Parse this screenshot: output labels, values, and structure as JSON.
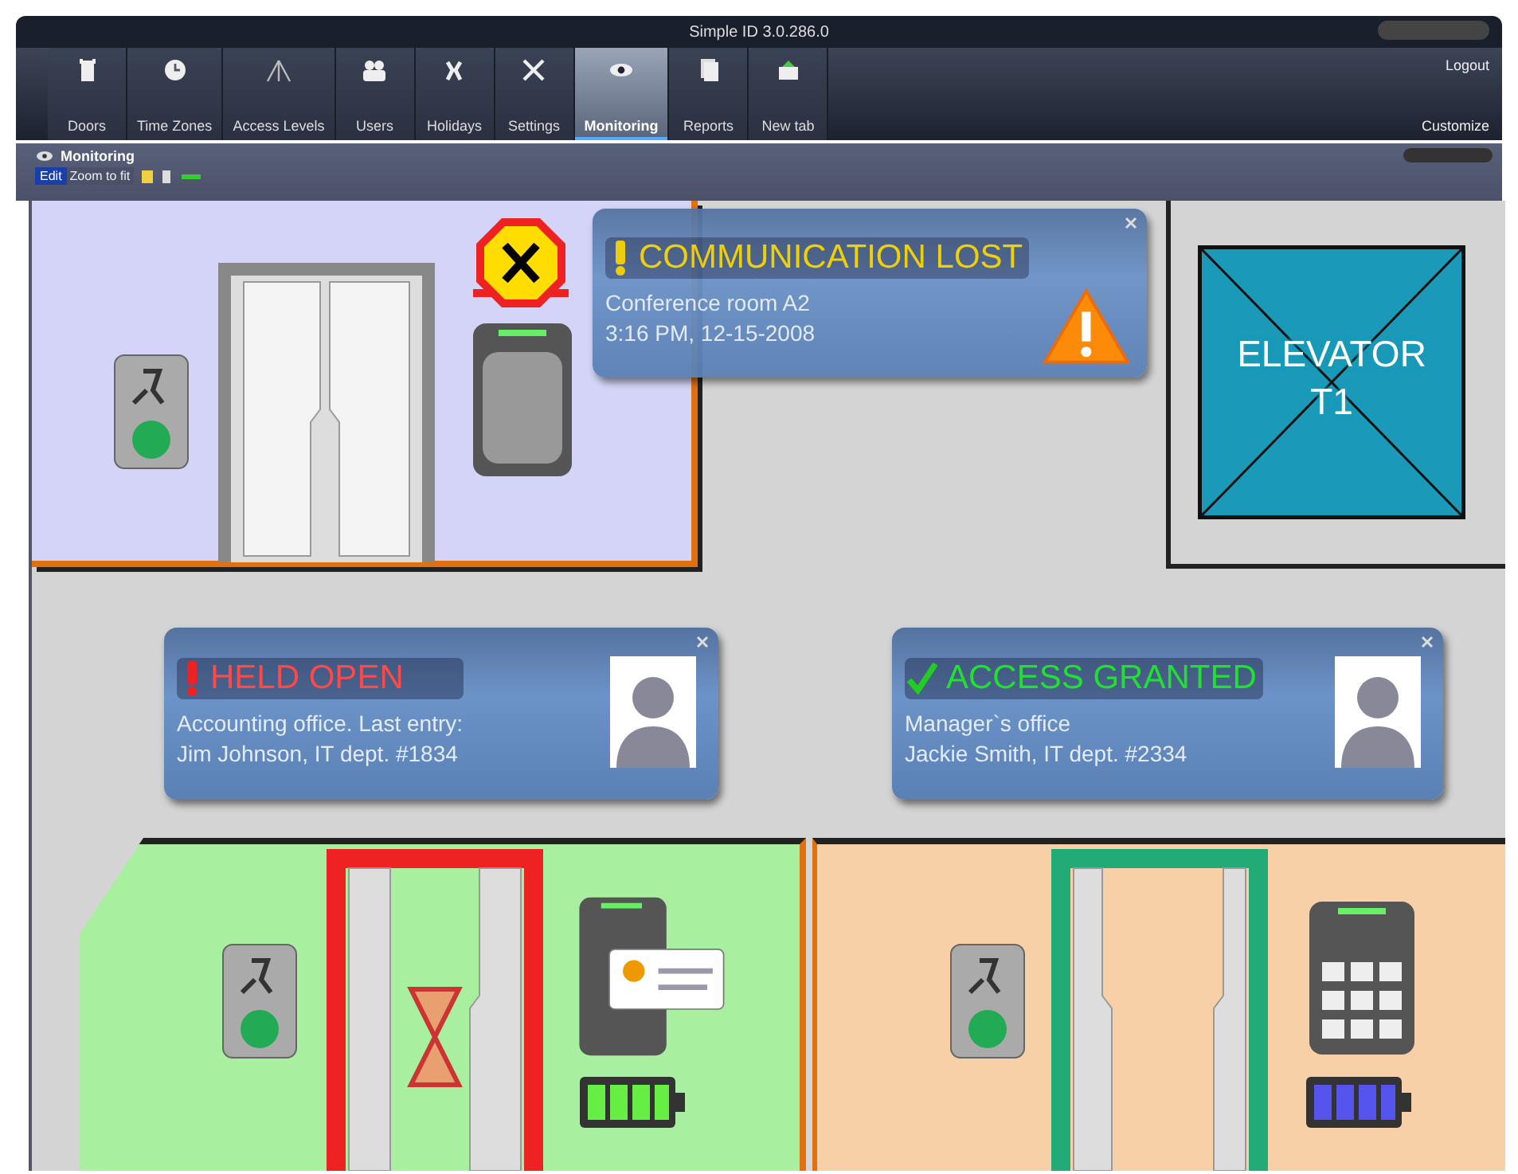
{
  "window": {
    "title": "Simple ID 3.0.286.0"
  },
  "tabs": [
    {
      "label": "Doors",
      "selected": false
    },
    {
      "label": "Time Zones",
      "selected": false
    },
    {
      "label": "Access Levels",
      "selected": false
    },
    {
      "label": "Users",
      "selected": false
    },
    {
      "label": "Holidays",
      "selected": false
    },
    {
      "label": "Settings",
      "selected": false
    },
    {
      "label": "Monitoring",
      "selected": true
    },
    {
      "label": "Reports",
      "selected": false
    },
    {
      "label": "New tab",
      "selected": false
    }
  ],
  "top_links": [
    "Logout",
    "Customize"
  ],
  "panel": {
    "title": "Monitoring",
    "toolbar": {
      "edit": "Edit",
      "zoom": "Zoom to fit"
    }
  },
  "floor_plan": {
    "elevator": {
      "label": "ELEVATOR T1"
    },
    "alerts": [
      {
        "kind": "warning",
        "title": "COMMUNICATION LOST",
        "lines": [
          "Conference room A2",
          "3:16 PM, 12-15-2008"
        ]
      },
      {
        "kind": "held",
        "title": "HELD OPEN",
        "lines": [
          "Accounting office. Last entry:",
          "Jim Johnson, IT dept. #1834"
        ]
      },
      {
        "kind": "granted",
        "title": "ACCESS GRANTED",
        "lines": [
          "Manager`s office",
          "Jackie Smith, IT dept. #2334"
        ]
      }
    ]
  }
}
